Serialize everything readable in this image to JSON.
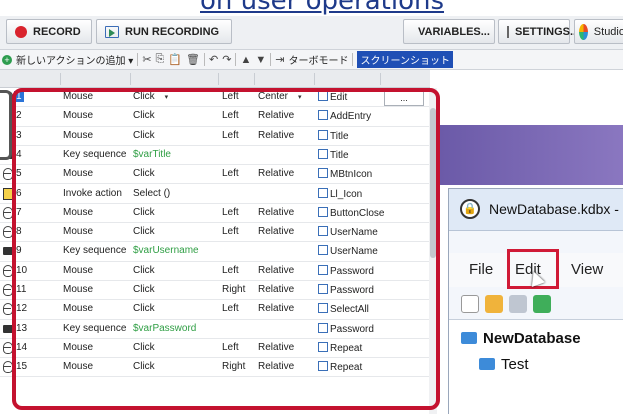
{
  "heading": "on user operations",
  "toolbar": {
    "record_label": "RECORD",
    "run_recording_label": "RUN RECORDING",
    "variables_label": "VARIABLES...",
    "settings_label": "SETTINGS...",
    "studio_label": "Studio"
  },
  "toolbar2": {
    "add_action_label": "新しいアクションの追加 ▾",
    "turbo_mode_label": "ターボモード",
    "screenshot_label": "スクリーンショット"
  },
  "rows": [
    {
      "num": "1",
      "icon": "mouse",
      "type": "Mouse",
      "action": "Click",
      "button": "Left",
      "mode": "Center",
      "target_icon": "menu-item-icon",
      "target": "Edit",
      "extra": "..."
    },
    {
      "num": "2",
      "icon": "mouse",
      "type": "Mouse",
      "action": "Click",
      "button": "Left",
      "mode": "Relative",
      "target_icon": "menu-item-icon",
      "target": "AddEntry"
    },
    {
      "num": "3",
      "icon": "mouse",
      "type": "Mouse",
      "action": "Click",
      "button": "Left",
      "mode": "Relative",
      "target_icon": "document-icon",
      "target": "Title"
    },
    {
      "num": "4",
      "icon": "keyboard",
      "type": "Key sequence",
      "action": "$varTitle",
      "button": "",
      "mode": "",
      "target_icon": "document-icon",
      "target": "Title"
    },
    {
      "num": "5",
      "icon": "mouse",
      "type": "Mouse",
      "action": "Click",
      "button": "Left",
      "mode": "Relative",
      "target_icon": "button-icon",
      "target": "MBtnIcon"
    },
    {
      "num": "6",
      "icon": "invoke",
      "type": "Invoke action",
      "action": "Select ()",
      "button": "",
      "mode": "",
      "target_icon": "list-item-icon",
      "target": "Ll_Icon"
    },
    {
      "num": "7",
      "icon": "mouse",
      "type": "Mouse",
      "action": "Click",
      "button": "Left",
      "mode": "Relative",
      "target_icon": "button-icon",
      "target": "ButtonClose"
    },
    {
      "num": "8",
      "icon": "mouse",
      "type": "Mouse",
      "action": "Click",
      "button": "Left",
      "mode": "Relative",
      "target_icon": "document-icon",
      "target": "UserName"
    },
    {
      "num": "9",
      "icon": "keyboard",
      "type": "Key sequence",
      "action": "$varUsername",
      "button": "",
      "mode": "",
      "target_icon": "document-icon",
      "target": "UserName"
    },
    {
      "num": "10",
      "icon": "mouse",
      "type": "Mouse",
      "action": "Click",
      "button": "Left",
      "mode": "Relative",
      "target_icon": "document-icon",
      "target": "Password"
    },
    {
      "num": "11",
      "icon": "mouse",
      "type": "Mouse",
      "action": "Click",
      "button": "Right",
      "mode": "Relative",
      "target_icon": "document-icon",
      "target": "Password"
    },
    {
      "num": "12",
      "icon": "mouse",
      "type": "Mouse",
      "action": "Click",
      "button": "Left",
      "mode": "Relative",
      "target_icon": "menu-item-icon",
      "target": "SelectAll"
    },
    {
      "num": "13",
      "icon": "keyboard",
      "type": "Key sequence",
      "action": "$varPassword",
      "button": "",
      "mode": "",
      "target_icon": "document-icon",
      "target": "Password"
    },
    {
      "num": "14",
      "icon": "mouse",
      "type": "Mouse",
      "action": "Click",
      "button": "Left",
      "mode": "Relative",
      "target_icon": "document-icon",
      "target": "Repeat"
    },
    {
      "num": "15",
      "icon": "mouse",
      "type": "Mouse",
      "action": "Click",
      "button": "Right",
      "mode": "Relative",
      "target_icon": "document-icon",
      "target": "Repeat"
    }
  ],
  "keepass": {
    "window_title": "NewDatabase.kdbx - I",
    "menu_file": "File",
    "menu_edit": "Edit",
    "menu_view": "View",
    "tree_root": "NewDatabase",
    "tree_child": "Test"
  },
  "colors": {
    "record": "#d9232d",
    "highlight": "#c4122f",
    "selected_row": "#2b74d8",
    "variable_text": "#2f9e44"
  }
}
